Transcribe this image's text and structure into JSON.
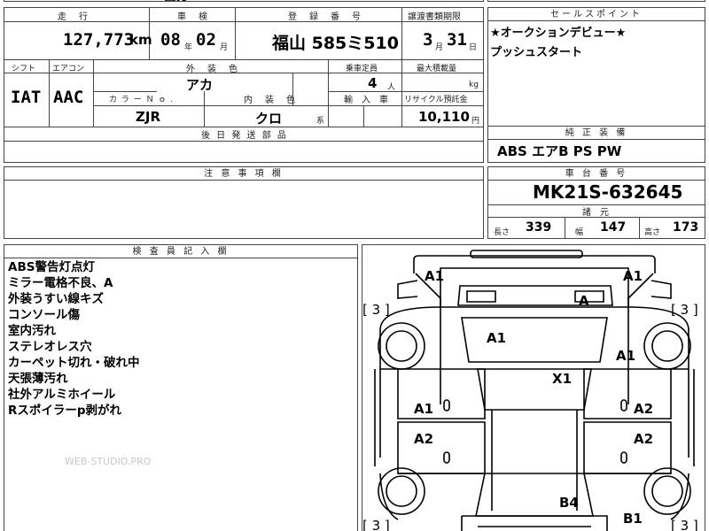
{
  "top_partial": {
    "fragment": "面分"
  },
  "vehicle_info": {
    "headers": {
      "mileage": "走　行",
      "inspection": "車　検",
      "registration_no": "登　録　番　号",
      "transfer_deadline": "譲渡書類期限"
    },
    "mileage_value": "127,773",
    "mileage_unit": "km",
    "inspection_year": "08",
    "inspection_year_unit": "年",
    "inspection_month": "02",
    "inspection_month_unit": "月",
    "registration": "福山 585ミ510",
    "deadline_month": "3",
    "deadline_month_unit": "月",
    "deadline_day": "31",
    "deadline_day_unit": "日",
    "shift_label": "シフト",
    "aircon_label": "エアコン",
    "exterior_color_label": "外　装　色",
    "capacity_label": "乗車定員",
    "max_load_label": "最大積載量",
    "shift_value": "IAT",
    "aircon_value": "AAC",
    "exterior_color_value": "アカ",
    "capacity_value": "4",
    "capacity_unit": "人",
    "max_load_unit": "kg",
    "color_no_label": "カ ラ ー Ｎ ｏ .",
    "interior_color_label": "内　装　色",
    "import_label": "輸　入　車",
    "recycle_label": "リサイクル預託金",
    "color_no_value": "ZJR",
    "interior_color_value": "クロ",
    "interior_color_suffix": "系",
    "recycle_value": "10,110",
    "recycle_unit": "円",
    "later_parts_label": "後 日 発 送 部 品"
  },
  "sales_points": {
    "header": "セールスポイント",
    "lines": [
      "★オークションデビュー★",
      "プッシュスタート"
    ]
  },
  "equipment": {
    "header": "純 正 装 備",
    "value": "ABS エアB PS PW"
  },
  "caution": {
    "header": "注 意 事 項 欄"
  },
  "chassis": {
    "header": "車 台 番 号",
    "value": "MK21S-632645",
    "dims_header": "諸　元",
    "length_label": "長さ",
    "length_value": "339",
    "width_label": "幅",
    "width_value": "147",
    "height_label": "高さ",
    "height_value": "173"
  },
  "inspector": {
    "header": "検 査 員 記 入 欄",
    "notes": [
      "ABS警告灯点灯",
      "ミラー電格不良、A",
      "外装うすい線キズ",
      "コンソール傷",
      "室内汚れ",
      "ステレオレス穴",
      "カーペット切れ・破れ中",
      "天張薄汚れ",
      "社外アルミホイール",
      "Rスポイラーp剥がれ"
    ],
    "watermark": "WEB-STUDIO.PRO"
  },
  "diagram": {
    "marks": {
      "front_left": "A1",
      "front_right": "A1",
      "hood": "A",
      "windshield": "A1",
      "front_fender_right": "A1",
      "roof": "X1",
      "front_door_left": "A1",
      "front_door_right": "A2",
      "rear_door_left": "A2",
      "rear_door_right": "A2",
      "tailgate": "B4",
      "rear_right": "B1"
    },
    "tires": {
      "front_left": "[ 3 ]",
      "front_right": "[ 3 ]",
      "rear_left": "[ 3 ]",
      "rear_right": "[ 3 ]"
    }
  }
}
